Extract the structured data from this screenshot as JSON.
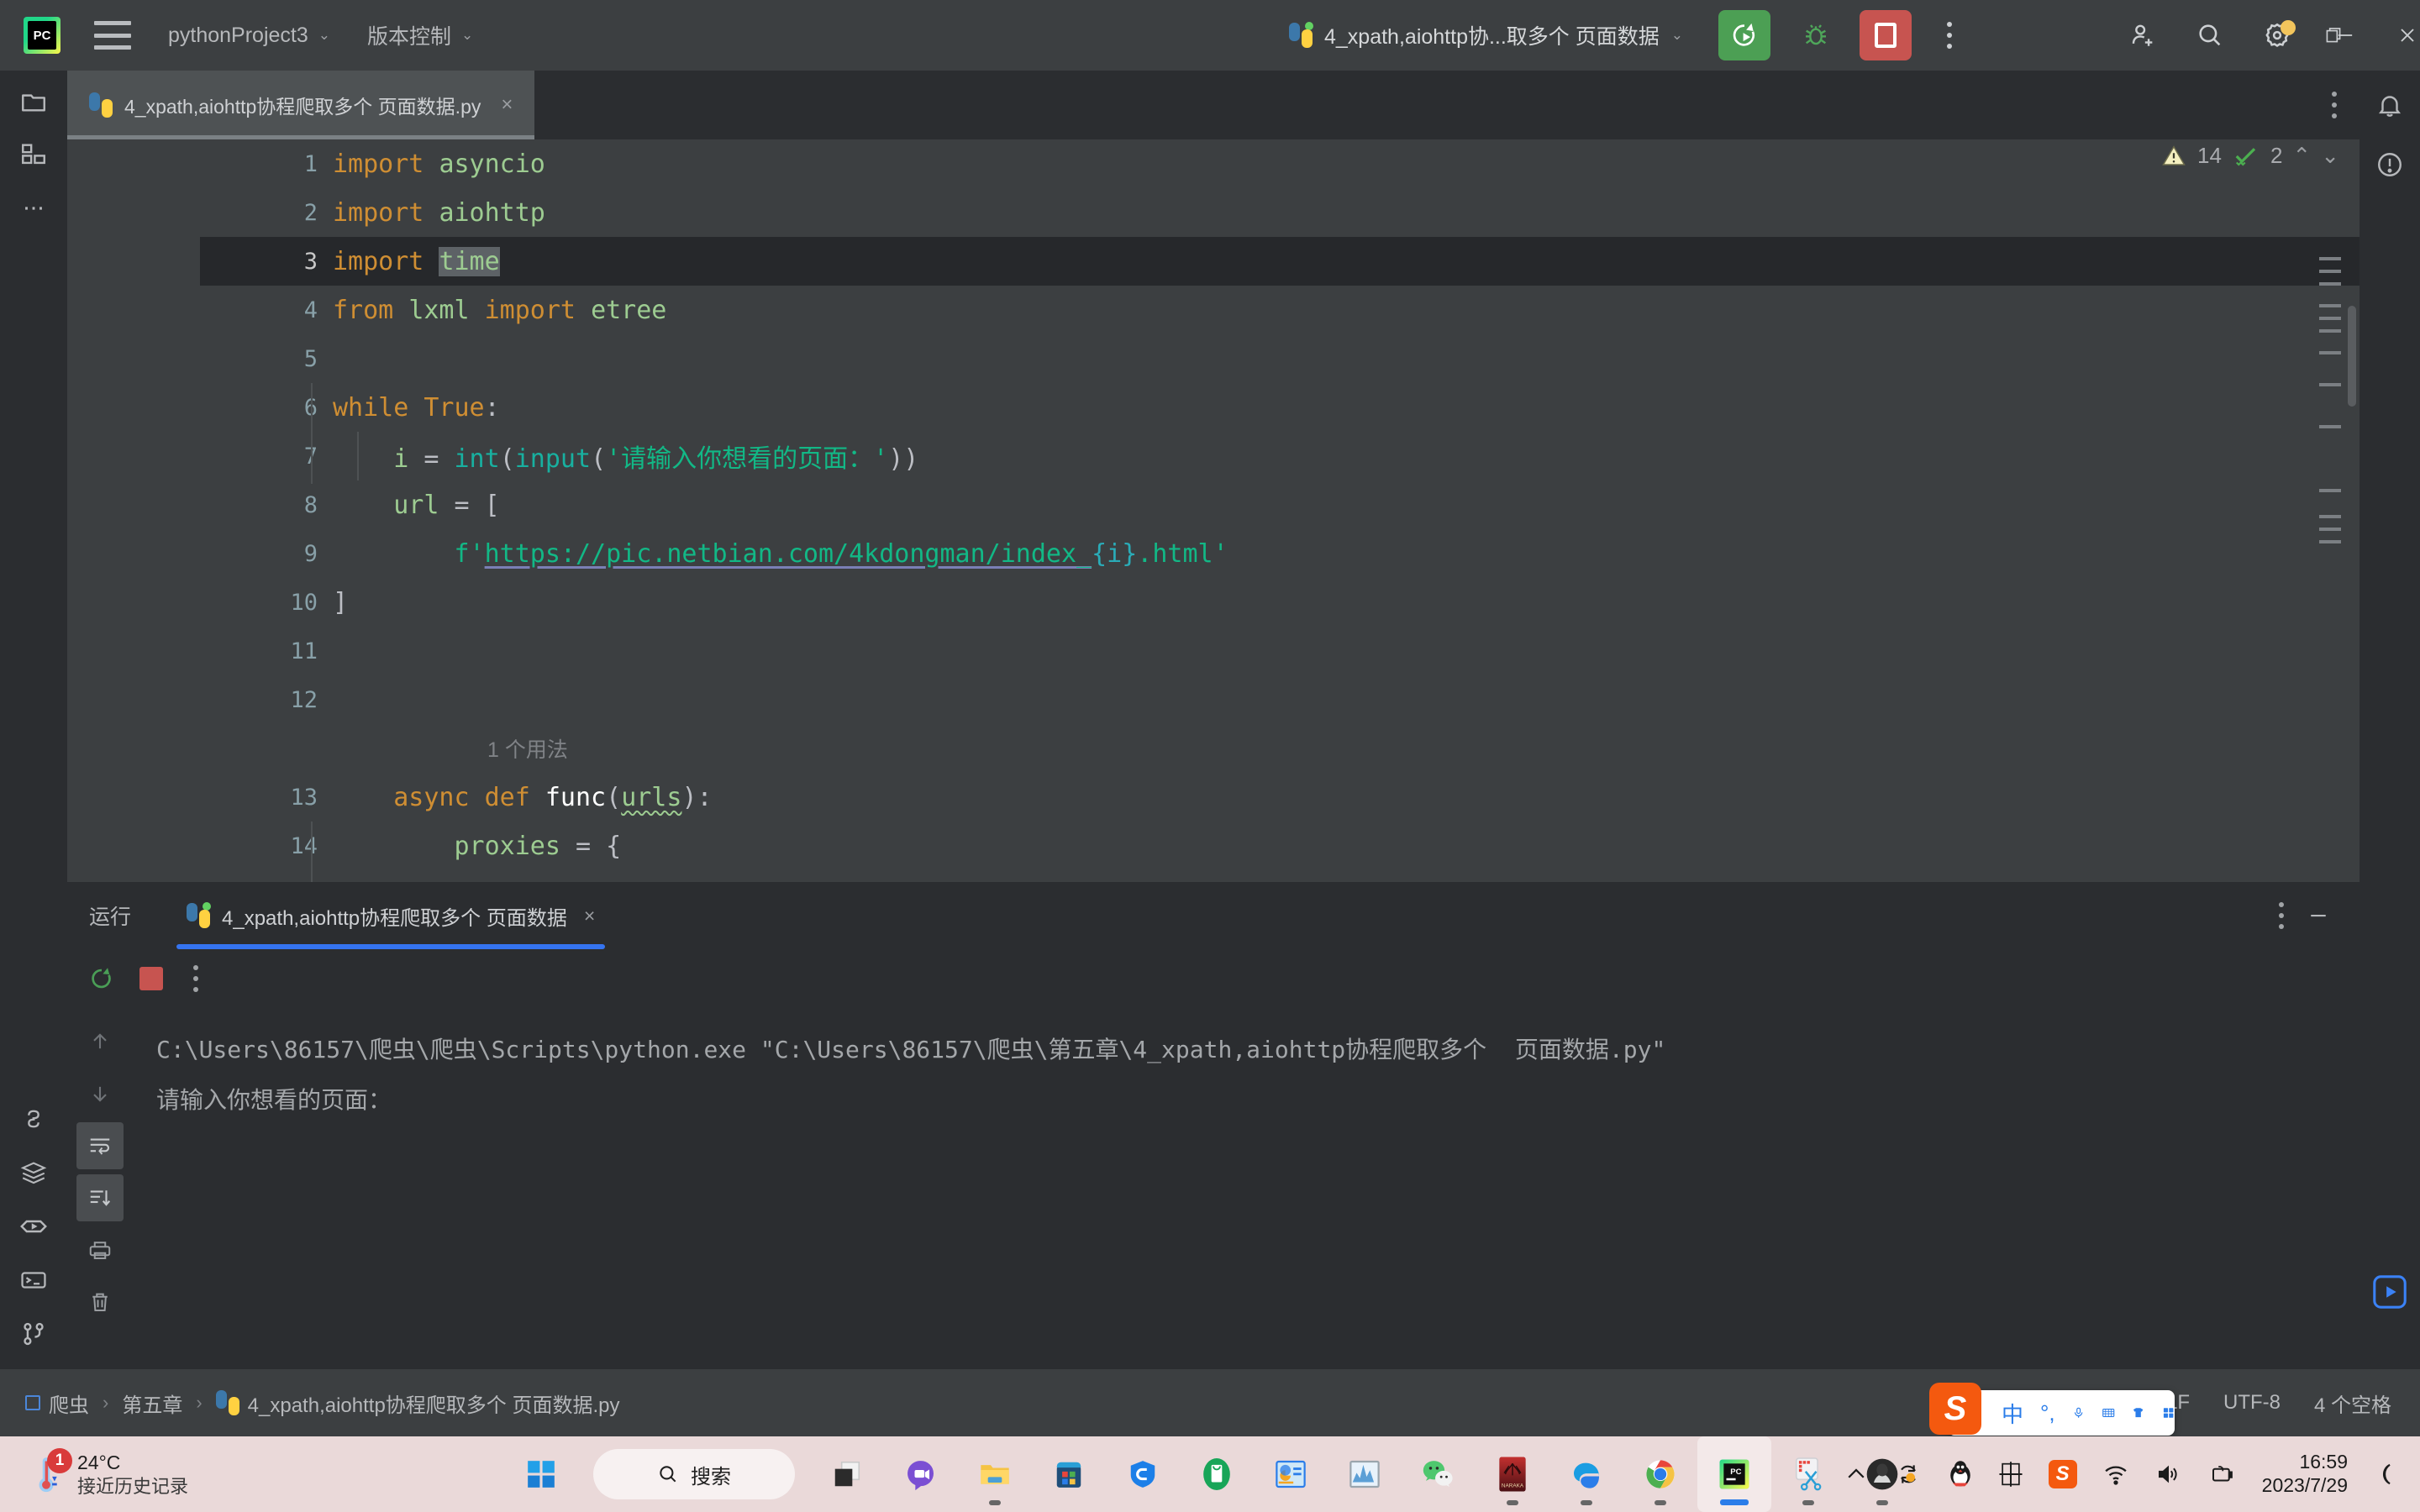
{
  "titlebar": {
    "logo": "pycharm-logo",
    "logo_text": "PC",
    "project_name": "pythonProject3",
    "vcs_label": "版本控制",
    "run_config": "4_xpath,aiohttp协...取多个 页面数据",
    "icons": {
      "menu": "hamburger-icon",
      "run": "run-icon",
      "debug": "debug-bug-icon",
      "stop": "stop-icon",
      "more": "more-options-icon",
      "add_user": "add-user-icon",
      "search": "search-icon",
      "settings": "settings-gear-icon",
      "minimize": "minimize-icon",
      "maximize": "maximize-icon",
      "close": "close-icon"
    }
  },
  "tab": {
    "filename": "4_xpath,aiohttp协程爬取多个 页面数据.py",
    "close": "×"
  },
  "editor": {
    "inspection": {
      "warnings": "14",
      "checks": "2"
    },
    "lines": [
      {
        "num": "1",
        "tokens": [
          {
            "t": "import",
            "c": "kw"
          },
          {
            "t": " ",
            "c": "pl"
          },
          {
            "t": "asyncio",
            "c": "id"
          }
        ]
      },
      {
        "num": "2",
        "tokens": [
          {
            "t": "import",
            "c": "kw"
          },
          {
            "t": " ",
            "c": "pl"
          },
          {
            "t": "aiohttp",
            "c": "id"
          }
        ]
      },
      {
        "num": "3",
        "current": true,
        "tokens": [
          {
            "t": "import",
            "c": "kw"
          },
          {
            "t": " ",
            "c": "pl"
          },
          {
            "t": "time",
            "c": "id sel"
          }
        ]
      },
      {
        "num": "4",
        "tokens": [
          {
            "t": "from",
            "c": "kw"
          },
          {
            "t": " ",
            "c": "pl"
          },
          {
            "t": "lxml",
            "c": "id"
          },
          {
            "t": " ",
            "c": "pl"
          },
          {
            "t": "import",
            "c": "kw"
          },
          {
            "t": " ",
            "c": "pl"
          },
          {
            "t": "etree",
            "c": "id"
          }
        ]
      },
      {
        "num": "5",
        "tokens": []
      },
      {
        "num": "6",
        "tokens": [
          {
            "t": "while",
            "c": "kw"
          },
          {
            "t": " ",
            "c": "pl"
          },
          {
            "t": "True",
            "c": "kw"
          },
          {
            "t": ":",
            "c": "pl"
          }
        ]
      },
      {
        "num": "7",
        "tokens": [
          {
            "t": "    i ",
            "c": "id"
          },
          {
            "t": "= ",
            "c": "pl"
          },
          {
            "t": "int",
            "c": "bi"
          },
          {
            "t": "(",
            "c": "pl"
          },
          {
            "t": "input",
            "c": "bi"
          },
          {
            "t": "(",
            "c": "pl"
          },
          {
            "t": "'请输入你想看的页面：'",
            "c": "str"
          },
          {
            "t": "))",
            "c": "pl"
          }
        ]
      },
      {
        "num": "8",
        "tokens": [
          {
            "t": "    url ",
            "c": "id"
          },
          {
            "t": "= [",
            "c": "pl"
          }
        ]
      },
      {
        "num": "9",
        "tokens": [
          {
            "t": "        f'",
            "c": "str"
          },
          {
            "t": "https://pic.netbian.com/4kdongman/index_",
            "c": "str ulink"
          },
          {
            "t": "{i}",
            "c": "num"
          },
          {
            "t": ".html'",
            "c": "str"
          }
        ]
      },
      {
        "num": "10",
        "tokens": [
          {
            "t": "]",
            "c": "pl"
          }
        ]
      },
      {
        "num": "11",
        "tokens": []
      },
      {
        "num": "12",
        "tokens": []
      },
      {
        "num": "",
        "inlay": "1 个用法"
      },
      {
        "num": "13",
        "tokens": [
          {
            "t": "    async",
            "c": "kw"
          },
          {
            "t": " ",
            "c": "pl"
          },
          {
            "t": "def",
            "c": "kw"
          },
          {
            "t": " ",
            "c": "pl"
          },
          {
            "t": "func",
            "c": "fn"
          },
          {
            "t": "(",
            "c": "pl"
          },
          {
            "t": "urls",
            "c": "id wavy"
          },
          {
            "t": "):",
            "c": "pl"
          }
        ]
      },
      {
        "num": "14",
        "tokens": [
          {
            "t": "        proxies ",
            "c": "id"
          },
          {
            "t": "= {",
            "c": "pl"
          }
        ]
      }
    ]
  },
  "run_window": {
    "label": "运行",
    "tab_title": "4_xpath,aiohttp协程爬取多个 页面数据",
    "tab_close": "×",
    "console": [
      "C:\\Users\\86157\\爬虫\\爬虫\\Scripts\\python.exe \"C:\\Users\\86157\\爬虫\\第五章\\4_xpath,aiohttp协程爬取多个  页面数据.py\"",
      "请输入你想看的页面："
    ],
    "toolbar_icons": [
      "rerun-icon",
      "stop-icon",
      "more-options-icon"
    ],
    "side_icons": [
      "scroll-up-icon",
      "scroll-down-icon",
      "soft-wrap-icon",
      "scroll-to-end-icon",
      "print-icon",
      "clear-all-icon"
    ],
    "header_icons": [
      "more-options-icon",
      "hide-icon"
    ]
  },
  "statusbar": {
    "breadcrumb": [
      {
        "label": "爬虫",
        "icon": "module-icon"
      },
      {
        "label": "第五章",
        "icon": ""
      },
      {
        "label": "4_xpath,aiohttp协程爬取多个 页面数据.py",
        "icon": "python-file-icon"
      }
    ],
    "separator": "›",
    "line_sep": "CRLF",
    "encoding": "UTF-8",
    "indent": "4 个空格"
  },
  "ime": {
    "logo": "S",
    "mode": "中",
    "icons": [
      "punctuation-icon",
      "microphone-icon",
      "keyboard-icon",
      "skin-icon",
      "toolbox-icon"
    ]
  },
  "taskbar": {
    "weather": {
      "temp": "24°C",
      "desc": "接近历史记录",
      "badge": "1",
      "icon": "thermometer-icon"
    },
    "search_placeholder": "搜索",
    "apps": [
      {
        "name": "start-button",
        "icon": "windows-logo"
      },
      {
        "name": "taskview-button",
        "icon": "task-view-icon"
      },
      {
        "name": "chat-button",
        "icon": "chat-icon"
      },
      {
        "name": "file-explorer",
        "icon": "folder-icon",
        "running": true
      },
      {
        "name": "microsoft-store",
        "icon": "store-icon"
      },
      {
        "name": "security-app",
        "icon": "shield-icon"
      },
      {
        "name": "green-app",
        "icon": "green-bag-icon"
      },
      {
        "name": "chart-app",
        "icon": "chart-icon"
      },
      {
        "name": "graph-app",
        "icon": "graph-icon"
      },
      {
        "name": "wechat",
        "icon": "wechat-icon"
      },
      {
        "name": "naraka-game",
        "icon": "naraka-icon",
        "label": "NARAKA",
        "running": true
      },
      {
        "name": "edge-browser",
        "icon": "edge-icon",
        "running": true
      },
      {
        "name": "chrome-browser",
        "icon": "chrome-icon",
        "running": true
      },
      {
        "name": "pycharm",
        "icon": "pycharm-icon",
        "active": true
      },
      {
        "name": "snipping-tool",
        "icon": "scissors-icon",
        "running": true
      },
      {
        "name": "avatar-app",
        "icon": "avatar-icon",
        "running": true
      }
    ],
    "tray": {
      "chevron": "chevron-up-icon",
      "items": [
        "sync-icon",
        "qq-icon",
        "ime-cn-icon",
        "sogou-icon",
        "wifi-icon",
        "volume-icon",
        "battery-icon"
      ],
      "time": "16:59",
      "date": "2023/7/29",
      "notification": "moon-icon"
    }
  }
}
